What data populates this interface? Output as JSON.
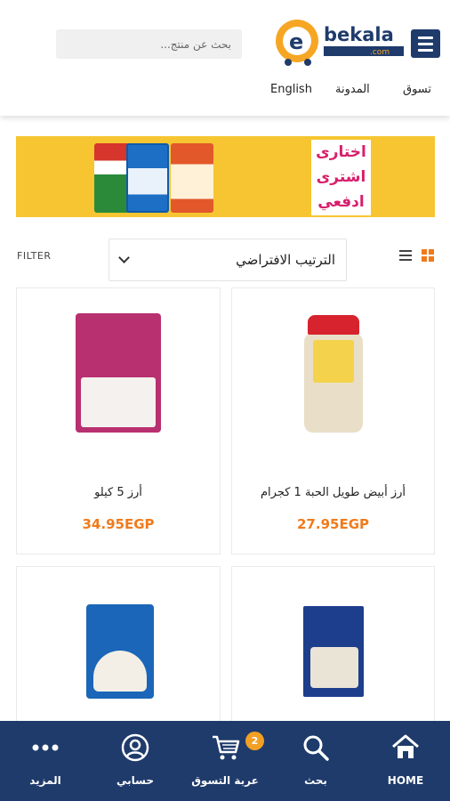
{
  "header": {
    "brand": "bekala",
    "brand_suffix": ".com",
    "search_placeholder": "بحث عن منتج...",
    "nav": {
      "shop": "تسوق",
      "blog": "المدونة",
      "language": "English"
    }
  },
  "banner": {
    "lines": [
      "اختارى",
      "اشترى",
      "ادفعي"
    ],
    "colors": {
      "background": "#f6c531",
      "text": "#d81f6b"
    }
  },
  "toolbar": {
    "filter_label": "FILTER",
    "sort_selected": "الترتيب الافتراضي",
    "view_icons": [
      "list-view-icon",
      "grid-view-icon"
    ]
  },
  "products": [
    {
      "name": "أرز أبيض طويل الحبة 1 كجرام",
      "price": "27.95EGP"
    },
    {
      "name": "أرز 5 كيلو",
      "price": "34.95EGP"
    },
    {
      "name": "",
      "price": ""
    },
    {
      "name": "",
      "price": ""
    }
  ],
  "bottom_nav": {
    "home": "HOME",
    "search": "بحث",
    "cart": "عربة التسوق",
    "cart_count": "2",
    "account": "حسابي",
    "more": "المزيد"
  },
  "colors": {
    "primary": "#1f3b6b",
    "accent": "#f07b1d",
    "badge": "#f2a024"
  }
}
